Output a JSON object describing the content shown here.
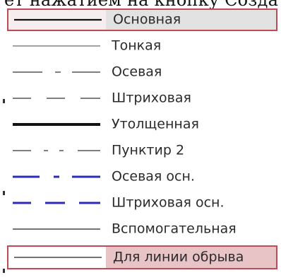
{
  "header": {
    "text": "ет нажатием на кнопку Созда"
  },
  "line_styles": {
    "items": [
      {
        "label": "Основная",
        "icon": "line-solid-main-icon"
      },
      {
        "label": "Тонкая",
        "icon": "line-thin-icon"
      },
      {
        "label": "Осевая",
        "icon": "line-dash-dot-icon"
      },
      {
        "label": "Штриховая",
        "icon": "line-dashed-icon"
      },
      {
        "label": "Утолщенная",
        "icon": "line-thick-icon"
      },
      {
        "label": "Пунктир 2",
        "icon": "line-dotted-icon"
      },
      {
        "label": "Осевая осн.",
        "icon": "line-dash-dot-main-blue-icon"
      },
      {
        "label": "Штриховая осн.",
        "icon": "line-dashed-main-blue-icon"
      },
      {
        "label": "Вспомогательная",
        "icon": "line-auxiliary-icon"
      },
      {
        "label": "Для линии обрыва",
        "icon": "line-break-icon"
      }
    ],
    "selected_index": 0,
    "highlighted_index": 9
  },
  "colors": {
    "selection_border": "#c04a56",
    "selected_label_bg": "#e2e2e2",
    "highlight_label_bg": "#e9c4c6",
    "line_black": "#1a1a1a",
    "line_gray": "#555555",
    "line_blue": "#2b2bb8"
  }
}
